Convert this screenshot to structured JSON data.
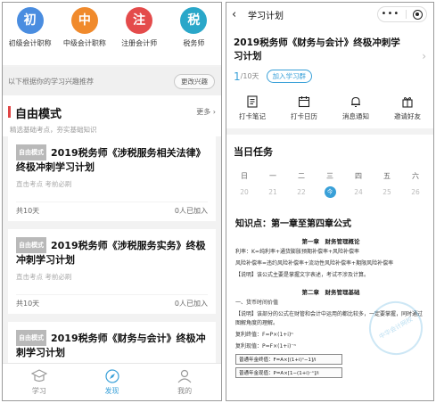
{
  "left": {
    "categories": [
      {
        "glyph": "初",
        "label": "初级会计职称",
        "color": "#4a8de0"
      },
      {
        "glyph": "中",
        "label": "中级会计职称",
        "color": "#f08a2c"
      },
      {
        "glyph": "注",
        "label": "注册会计师",
        "color": "#e44b4b"
      },
      {
        "glyph": "税",
        "label": "税务师",
        "color": "#2aa7c9"
      }
    ],
    "recommend": {
      "text": "以下根据你的学习兴趣推荐",
      "button": "更改兴趣"
    },
    "free_mode": {
      "title": "自由模式",
      "more": "更多 ›",
      "subtitle": "精选基础考点，夯实基础知识"
    },
    "cards": [
      {
        "tag": "自由模式",
        "title": "2019税务师《涉税服务相关法律》终极冲刺学习计划",
        "subtitle": "直击考点 考前必刷",
        "days": "共10天",
        "joined": "0人已加入"
      },
      {
        "tag": "自由模式",
        "title": "2019税务师《涉税服务实务》终极冲刺学习计划",
        "subtitle": "直击考点 考前必刷",
        "days": "共10天",
        "joined": "0人已加入"
      },
      {
        "tag": "自由模式",
        "title": "2019税务师《财务与会计》终极冲刺学习计划",
        "subtitle": "",
        "days": "",
        "joined": ""
      }
    ],
    "tabs": [
      {
        "label": "学习",
        "icon": "graduation-cap-icon"
      },
      {
        "label": "发现",
        "icon": "compass-icon"
      },
      {
        "label": "我的",
        "icon": "user-icon"
      }
    ],
    "accent": "#39a0d8"
  },
  "right": {
    "nav": {
      "back": "‹",
      "title": "学习计划"
    },
    "plan": {
      "title": "2019税务师《财务与会计》终极冲刺学习计划",
      "current": "1",
      "total": "/10天",
      "join": "加入学习群"
    },
    "tools": [
      {
        "label": "打卡笔记",
        "icon": "note-icon"
      },
      {
        "label": "打卡日历",
        "icon": "calendar-icon"
      },
      {
        "label": "消息通知",
        "icon": "bell-icon"
      },
      {
        "label": "邀请好友",
        "icon": "gift-icon"
      }
    ],
    "today": "当日任务",
    "week": [
      {
        "wd": "日",
        "dn": "20"
      },
      {
        "wd": "一",
        "dn": "21"
      },
      {
        "wd": "二",
        "dn": "22"
      },
      {
        "wd": "三",
        "dn": "今"
      },
      {
        "wd": "四",
        "dn": "24"
      },
      {
        "wd": "五",
        "dn": "25"
      },
      {
        "wd": "六",
        "dn": "26"
      }
    ],
    "doc": {
      "title": "知识点：第一章至第四章公式",
      "ch1": "第一章　财务管理概论",
      "l1": "利率：K=纯利率+通货膨胀预期补偿率+风险补偿率",
      "l2": "风险补偿率=违约风险补偿率+流动性风险补偿率+期限风险补偿率",
      "l3": "【说明】该公式主要是掌握文字表述，考试不涉及计算。",
      "ch2": "第二章　财务管理基础",
      "l4": "一、货币时间价值",
      "l5": "【说明】该部分的公式在财管和会计中运用的都比较多，一定要掌握，同时通过图解角度的理解。",
      "l6": "复利终值：F=P×(1+i)ⁿ",
      "l7": "复利现值：P=F×(1+i)⁻ⁿ",
      "box1": "普通年金终值：F=A×[(1+i)ⁿ−1]/i",
      "box2": "普通年金现值：P=A×[1−(1+i)⁻ⁿ]/i",
      "watermark": "中华会计网校"
    }
  }
}
